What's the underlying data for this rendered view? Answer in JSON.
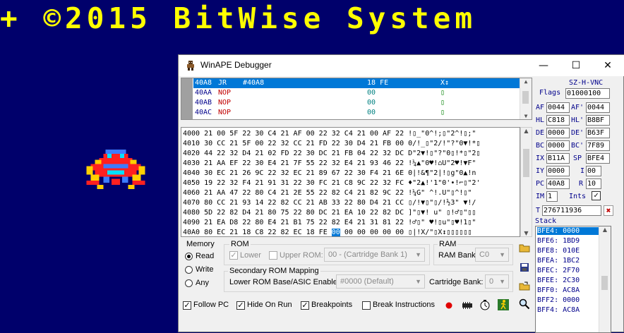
{
  "banner": {
    "text": "+ ©2015 BitWise System"
  },
  "window": {
    "title": "WinAPE Debugger",
    "controls": {
      "minimize": "—",
      "maximize": "☐",
      "close": "✕"
    }
  },
  "disassembly": {
    "rows": [
      {
        "addr": "40A8",
        "op": "JR",
        "arg": "#40A8",
        "bytes": "18 FE",
        "note": "X↕",
        "selected": true
      },
      {
        "addr": "40AA",
        "op": "NOP",
        "arg": "",
        "bytes": "00",
        "note": "▯",
        "selected": false
      },
      {
        "addr": "40AB",
        "op": "NOP",
        "arg": "",
        "bytes": "00",
        "note": "▯",
        "selected": false
      },
      {
        "addr": "40AC",
        "op": "NOP",
        "arg": "",
        "bytes": "00",
        "note": "▯",
        "selected": false
      }
    ]
  },
  "hexdump": {
    "rows": [
      {
        "addr": "4000",
        "hex": "21 00 5F 22 30 C4 21 AF 00 22 32 C4 21 00 AF 22",
        "ascii": "!▯_\"0^!;▯\"2^!▯;\""
      },
      {
        "addr": "4010",
        "hex": "30 CC 21 5F 00 22 32 CC 21 FD 22 30 D4 21 FB 00",
        "ascii": "0/!_▯\"2/!\"?\"0▼!*▯"
      },
      {
        "addr": "4020",
        "hex": "44 22 32 D4 21 02 FD 22 30 DC 21 FB 04 22 32 DC",
        "ascii": "D\"2▼!▯\"?\"0▯!*▯\"2▯"
      },
      {
        "addr": "4030",
        "hex": "21 AA EF 22 30 E4 21 7F 55 22 32 E4 21 93 46 22",
        "ascii": "!¼▲\"0♥!⌂U\"2♥!▼F\""
      },
      {
        "addr": "4040",
        "hex": "30 EC 21 26 9C 22 32 EC 21 89 67 22 30 F4 21 6E",
        "ascii": "0|!&¶\"2|!▯g\"0▲!n"
      },
      {
        "addr": "4050",
        "hex": "19 22 32 F4 21 91 31 22 30 FC 21 C8 9C 22 32 FC",
        "ascii": "♦\"2▲!'1\"0'∙!⌐▯\"2'"
      },
      {
        "addr": "4060",
        "hex": "21 AA 47 22 80 C4 21 2E 55 22 82 C4 21 82 9C 22",
        "ascii": "!¼G\" ^!.U\"▯^!▯\""
      },
      {
        "addr": "4070",
        "hex": "80 CC 21 93 14 22 82 CC 21 AB 33 22 80 D4 21 CC",
        "ascii": "▯/!▼▯\"▯/!½3\" ▼!/"
      },
      {
        "addr": "4080",
        "hex": "5D 22 82 D4 21 80 75 22 80 DC 21 EA 10 22 82 DC",
        "ascii": "]\"▯▼! u\" ▯!♂▯\"▯▯"
      },
      {
        "addr": "4090",
        "hex": "21 EA D8 22 80 E4 21 B1 75 22 82 E4 21 31 81 22",
        "ascii": "!♂▯\" ♥!▯u\"▯♥!1▯\""
      },
      {
        "addr": "40A0",
        "hex": "80 EC 21 18 C8 22 82 EC 18 FE",
        "hl": "00",
        "tail": "00 00 00 00 00",
        "ascii": "▯|!X/\"▯X↕▯▯▯▯▯▯"
      }
    ]
  },
  "registers": {
    "mode": "SZ-H-VNC",
    "flags_label": "Flags",
    "flags": "01000100",
    "AF": "0044",
    "AF2": "0044",
    "HL": "C818",
    "HL2": "B8BF",
    "DE": "0000",
    "DE2": "B63F",
    "BC": "0000",
    "BC2": "7F89",
    "IX": "B11A",
    "SP": "BFE4",
    "IY": "0000",
    "I": "00",
    "PC": "40A8",
    "R": "10",
    "IM": "1",
    "ints_label": "Ints",
    "T": "276711936"
  },
  "stack": {
    "label": "Stack",
    "rows": [
      "BFE4: 0000",
      "BFE6: 1BD9",
      "BFE8: 010E",
      "BFEA: 1BC2",
      "BFEC: 2F70",
      "BFEE: 2C30",
      "BFF0: AC8A",
      "BFF2: 0000",
      "BFF4: AC8A"
    ]
  },
  "memory": {
    "label": "Memory",
    "options": [
      "Read",
      "Write",
      "Any"
    ],
    "selected": "Read"
  },
  "rom": {
    "label": "ROM",
    "lower": "Lower",
    "upper": "Upper ROM:",
    "upper_value": "00 - (Cartridge Bank 1)"
  },
  "ram": {
    "label": "RAM",
    "bank_label": "RAM Bank:",
    "bank_value": "C0"
  },
  "secondary": {
    "label": "Secondary ROM Mapping",
    "base_label": "Lower ROM Base/ASIC Enable:",
    "base_value": "#0000 (Default)",
    "cart_label": "Cartridge Bank:",
    "cart_value": "0"
  },
  "bottom": {
    "follow_pc": "Follow PC",
    "hide_on_run": "Hide On Run",
    "breakpoints": "Breakpoints",
    "break_instr": "Break Instructions"
  }
}
